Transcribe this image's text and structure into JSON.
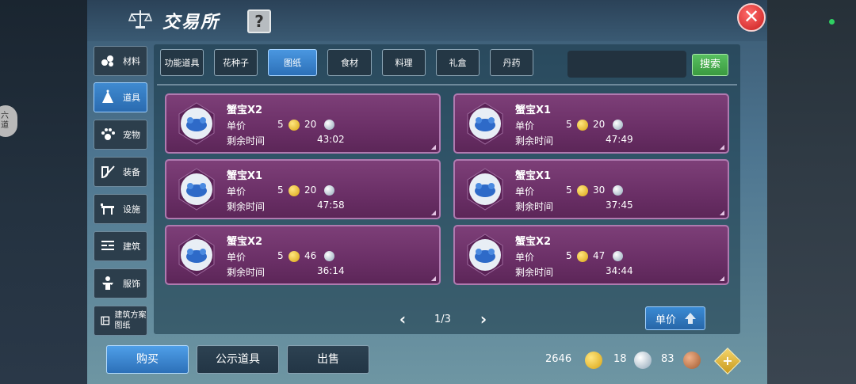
{
  "window": {
    "title": "交易所",
    "help_label": "?",
    "close_label": "✕",
    "side_badge": "六 道"
  },
  "sidebar": {
    "items": [
      {
        "label": "材料",
        "icon": "materials-icon",
        "active": false
      },
      {
        "label": "道具",
        "icon": "props-icon",
        "active": true
      },
      {
        "label": "宠物",
        "icon": "pet-paw-icon",
        "active": false
      },
      {
        "label": "装备",
        "icon": "equipment-icon",
        "active": false
      },
      {
        "label": "设施",
        "icon": "facility-icon",
        "active": false
      },
      {
        "label": "建筑",
        "icon": "building-icon",
        "active": false
      },
      {
        "label": "服饰",
        "icon": "clothing-icon",
        "active": false
      },
      {
        "label": "建筑方案图纸",
        "icon": "blueprint-icon",
        "active": false
      }
    ]
  },
  "tabs": [
    {
      "label": "功能道具",
      "active": false
    },
    {
      "label": "花种子",
      "active": false
    },
    {
      "label": "图纸",
      "active": true
    },
    {
      "label": "食材",
      "active": false
    },
    {
      "label": "料理",
      "active": false
    },
    {
      "label": "礼盒",
      "active": false
    },
    {
      "label": "丹药",
      "active": false
    }
  ],
  "search": {
    "placeholder": "",
    "button_label": "搜索"
  },
  "listing": {
    "unit_price_label": "单价",
    "time_label": "剩余时间",
    "items": [
      {
        "name": "蟹宝X2",
        "gold": "5",
        "silver": "20",
        "time": "43:02"
      },
      {
        "name": "蟹宝X1",
        "gold": "5",
        "silver": "20",
        "time": "47:49"
      },
      {
        "name": "蟹宝X1",
        "gold": "5",
        "silver": "20",
        "time": "47:58"
      },
      {
        "name": "蟹宝X1",
        "gold": "5",
        "silver": "30",
        "time": "37:45"
      },
      {
        "name": "蟹宝X2",
        "gold": "5",
        "silver": "46",
        "time": "36:14"
      },
      {
        "name": "蟹宝X2",
        "gold": "5",
        "silver": "47",
        "time": "34:44"
      }
    ]
  },
  "pagination": {
    "current": "1/3",
    "prev": "‹",
    "next": "›"
  },
  "sort": {
    "label": "单价"
  },
  "bottom": {
    "buy_label": "购买",
    "showcase_label": "公示道具",
    "sell_label": "出售"
  },
  "currency": {
    "gold": "2646",
    "silver": "18",
    "copper": "83",
    "add_label": "+"
  },
  "colors": {
    "accent_blue": "#2c70b8",
    "card_purple": "#6a2f66",
    "search_green": "#3a9a40",
    "close_red": "#c81d1d"
  }
}
